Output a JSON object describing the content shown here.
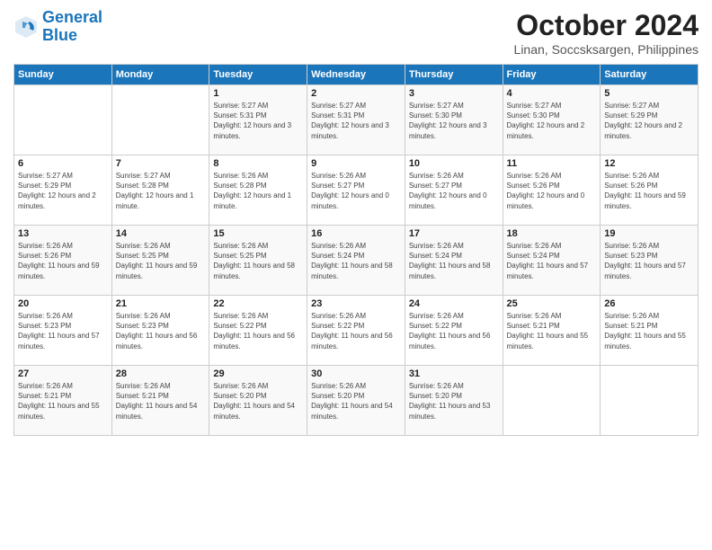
{
  "logo": {
    "line1": "General",
    "line2": "Blue"
  },
  "header": {
    "month": "October 2024",
    "location": "Linan, Soccsksargen, Philippines"
  },
  "weekdays": [
    "Sunday",
    "Monday",
    "Tuesday",
    "Wednesday",
    "Thursday",
    "Friday",
    "Saturday"
  ],
  "weeks": [
    [
      {
        "day": "",
        "info": ""
      },
      {
        "day": "",
        "info": ""
      },
      {
        "day": "1",
        "info": "Sunrise: 5:27 AM\nSunset: 5:31 PM\nDaylight: 12 hours and 3 minutes."
      },
      {
        "day": "2",
        "info": "Sunrise: 5:27 AM\nSunset: 5:31 PM\nDaylight: 12 hours and 3 minutes."
      },
      {
        "day": "3",
        "info": "Sunrise: 5:27 AM\nSunset: 5:30 PM\nDaylight: 12 hours and 3 minutes."
      },
      {
        "day": "4",
        "info": "Sunrise: 5:27 AM\nSunset: 5:30 PM\nDaylight: 12 hours and 2 minutes."
      },
      {
        "day": "5",
        "info": "Sunrise: 5:27 AM\nSunset: 5:29 PM\nDaylight: 12 hours and 2 minutes."
      }
    ],
    [
      {
        "day": "6",
        "info": "Sunrise: 5:27 AM\nSunset: 5:29 PM\nDaylight: 12 hours and 2 minutes."
      },
      {
        "day": "7",
        "info": "Sunrise: 5:27 AM\nSunset: 5:28 PM\nDaylight: 12 hours and 1 minute."
      },
      {
        "day": "8",
        "info": "Sunrise: 5:26 AM\nSunset: 5:28 PM\nDaylight: 12 hours and 1 minute."
      },
      {
        "day": "9",
        "info": "Sunrise: 5:26 AM\nSunset: 5:27 PM\nDaylight: 12 hours and 0 minutes."
      },
      {
        "day": "10",
        "info": "Sunrise: 5:26 AM\nSunset: 5:27 PM\nDaylight: 12 hours and 0 minutes."
      },
      {
        "day": "11",
        "info": "Sunrise: 5:26 AM\nSunset: 5:26 PM\nDaylight: 12 hours and 0 minutes."
      },
      {
        "day": "12",
        "info": "Sunrise: 5:26 AM\nSunset: 5:26 PM\nDaylight: 11 hours and 59 minutes."
      }
    ],
    [
      {
        "day": "13",
        "info": "Sunrise: 5:26 AM\nSunset: 5:26 PM\nDaylight: 11 hours and 59 minutes."
      },
      {
        "day": "14",
        "info": "Sunrise: 5:26 AM\nSunset: 5:25 PM\nDaylight: 11 hours and 59 minutes."
      },
      {
        "day": "15",
        "info": "Sunrise: 5:26 AM\nSunset: 5:25 PM\nDaylight: 11 hours and 58 minutes."
      },
      {
        "day": "16",
        "info": "Sunrise: 5:26 AM\nSunset: 5:24 PM\nDaylight: 11 hours and 58 minutes."
      },
      {
        "day": "17",
        "info": "Sunrise: 5:26 AM\nSunset: 5:24 PM\nDaylight: 11 hours and 58 minutes."
      },
      {
        "day": "18",
        "info": "Sunrise: 5:26 AM\nSunset: 5:24 PM\nDaylight: 11 hours and 57 minutes."
      },
      {
        "day": "19",
        "info": "Sunrise: 5:26 AM\nSunset: 5:23 PM\nDaylight: 11 hours and 57 minutes."
      }
    ],
    [
      {
        "day": "20",
        "info": "Sunrise: 5:26 AM\nSunset: 5:23 PM\nDaylight: 11 hours and 57 minutes."
      },
      {
        "day": "21",
        "info": "Sunrise: 5:26 AM\nSunset: 5:23 PM\nDaylight: 11 hours and 56 minutes."
      },
      {
        "day": "22",
        "info": "Sunrise: 5:26 AM\nSunset: 5:22 PM\nDaylight: 11 hours and 56 minutes."
      },
      {
        "day": "23",
        "info": "Sunrise: 5:26 AM\nSunset: 5:22 PM\nDaylight: 11 hours and 56 minutes."
      },
      {
        "day": "24",
        "info": "Sunrise: 5:26 AM\nSunset: 5:22 PM\nDaylight: 11 hours and 56 minutes."
      },
      {
        "day": "25",
        "info": "Sunrise: 5:26 AM\nSunset: 5:21 PM\nDaylight: 11 hours and 55 minutes."
      },
      {
        "day": "26",
        "info": "Sunrise: 5:26 AM\nSunset: 5:21 PM\nDaylight: 11 hours and 55 minutes."
      }
    ],
    [
      {
        "day": "27",
        "info": "Sunrise: 5:26 AM\nSunset: 5:21 PM\nDaylight: 11 hours and 55 minutes."
      },
      {
        "day": "28",
        "info": "Sunrise: 5:26 AM\nSunset: 5:21 PM\nDaylight: 11 hours and 54 minutes."
      },
      {
        "day": "29",
        "info": "Sunrise: 5:26 AM\nSunset: 5:20 PM\nDaylight: 11 hours and 54 minutes."
      },
      {
        "day": "30",
        "info": "Sunrise: 5:26 AM\nSunset: 5:20 PM\nDaylight: 11 hours and 54 minutes."
      },
      {
        "day": "31",
        "info": "Sunrise: 5:26 AM\nSunset: 5:20 PM\nDaylight: 11 hours and 53 minutes."
      },
      {
        "day": "",
        "info": ""
      },
      {
        "day": "",
        "info": ""
      }
    ]
  ]
}
